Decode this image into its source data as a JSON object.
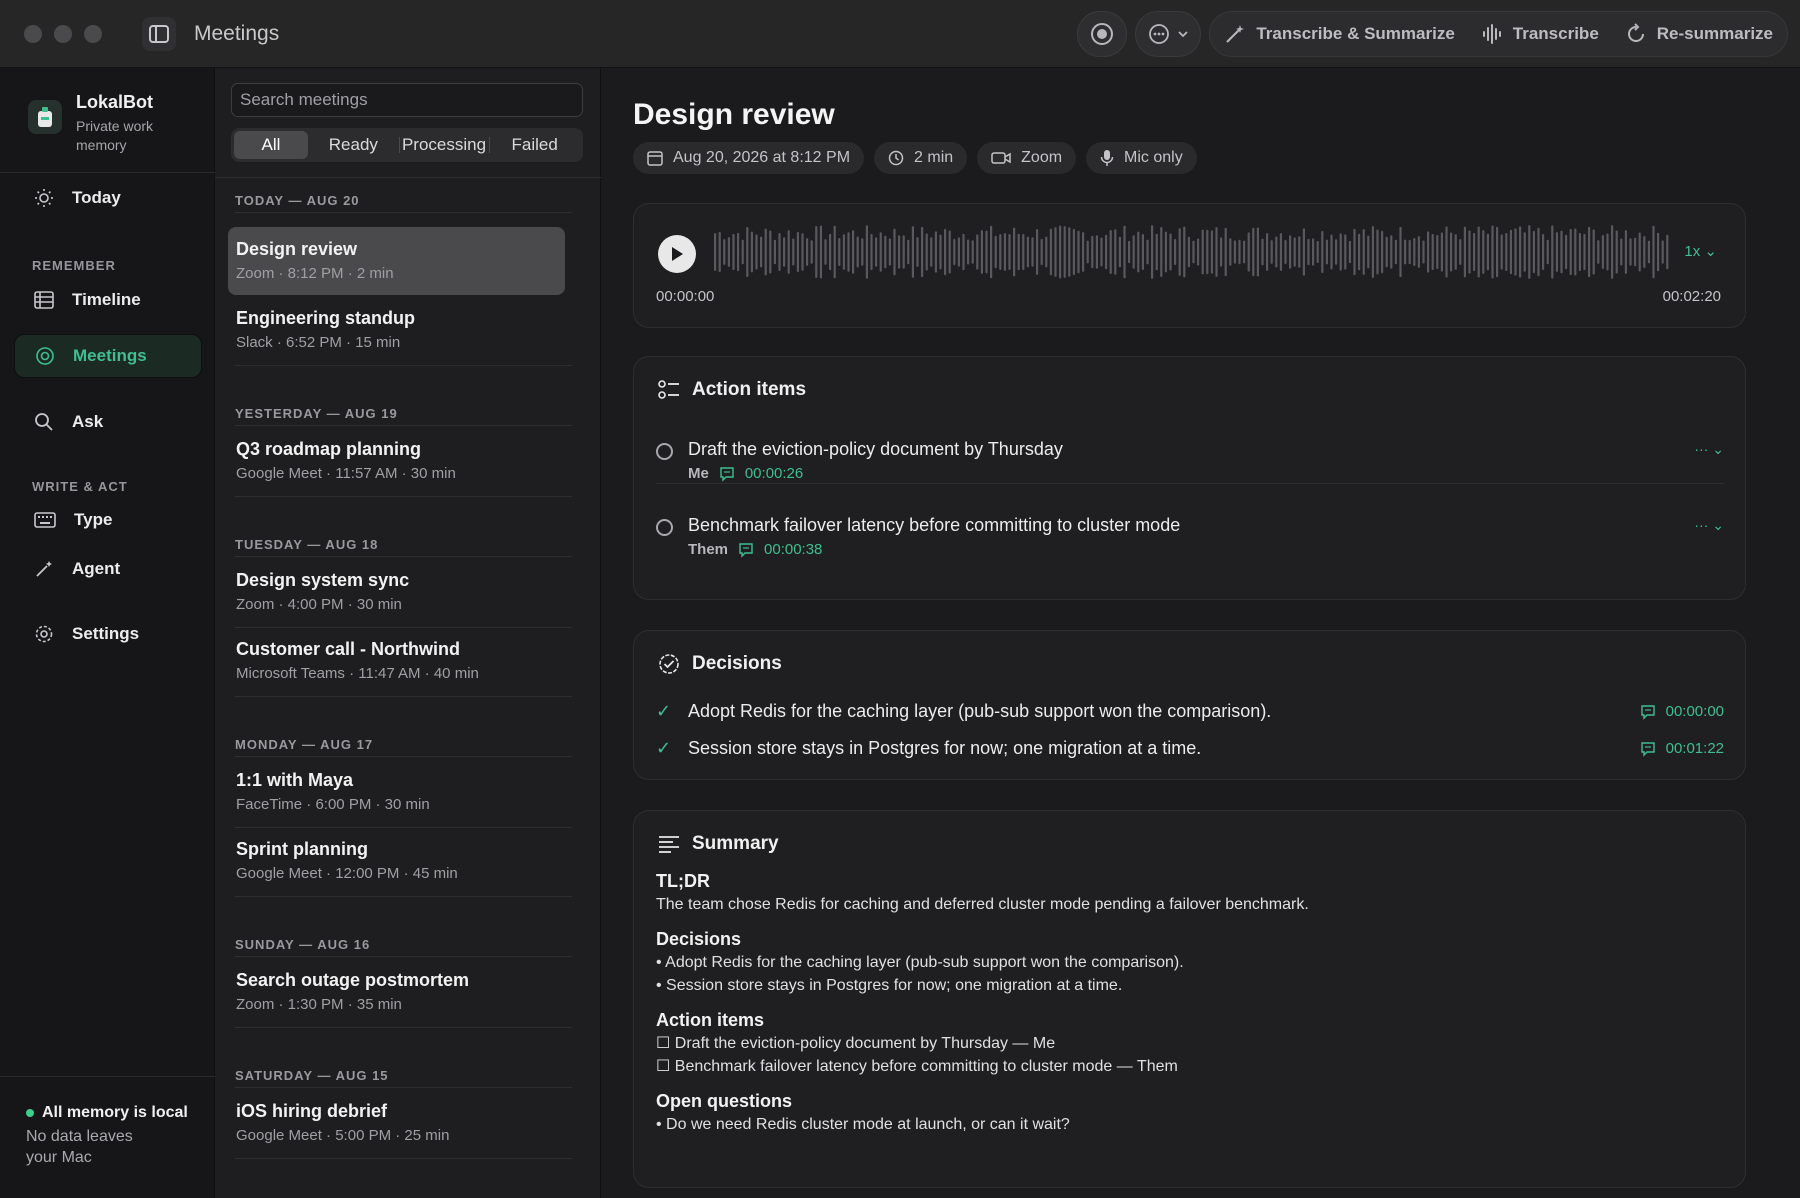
{
  "titlebar": {
    "title": "Meetings",
    "actions": {
      "transcribe_summarize": "Transcribe & Summarize",
      "transcribe": "Transcribe",
      "resummarize": "Re-summarize"
    }
  },
  "brand": {
    "name": "LokalBot",
    "subtitle": "Private work memory"
  },
  "nav": {
    "today": "Today",
    "section_remember": "REMEMBER",
    "timeline": "Timeline",
    "meetings": "Meetings",
    "ask": "Ask",
    "section_write": "WRITE & ACT",
    "type": "Type",
    "agent": "Agent",
    "settings": "Settings"
  },
  "local_status": {
    "title": "All memory is local",
    "subtitle": "No data leaves your Mac",
    "color": "#3ecf8e"
  },
  "list": {
    "search_placeholder": "Search meetings",
    "filters": [
      "All",
      "Ready",
      "Processing",
      "Failed"
    ],
    "active_filter": "All",
    "groups": [
      {
        "label": "TODAY — AUG 20",
        "meetings": [
          {
            "title": "Design review",
            "sub": "Zoom · 8:12 PM · 2 min",
            "selected": true
          },
          {
            "title": "Engineering standup",
            "sub": "Slack · 6:52 PM · 15 min"
          }
        ]
      },
      {
        "label": "YESTERDAY — AUG 19",
        "meetings": [
          {
            "title": "Q3 roadmap planning",
            "sub": "Google Meet · 11:57 AM · 30 min"
          }
        ]
      },
      {
        "label": "TUESDAY — AUG 18",
        "meetings": [
          {
            "title": "Design system sync",
            "sub": "Zoom · 4:00 PM · 30 min"
          },
          {
            "title": "Customer call - Northwind",
            "sub": "Microsoft Teams · 11:47 AM · 40 min"
          }
        ]
      },
      {
        "label": "MONDAY — AUG 17",
        "meetings": [
          {
            "title": "1:1 with Maya",
            "sub": "FaceTime · 6:00 PM · 30 min"
          },
          {
            "title": "Sprint planning",
            "sub": "Google Meet · 12:00 PM · 45 min"
          }
        ]
      },
      {
        "label": "SUNDAY — AUG 16",
        "meetings": [
          {
            "title": "Search outage postmortem",
            "sub": "Zoom · 1:30 PM · 35 min"
          }
        ]
      },
      {
        "label": "SATURDAY — AUG 15",
        "meetings": [
          {
            "title": "iOS hiring debrief",
            "sub": "Google Meet · 5:00 PM · 25 min"
          }
        ]
      }
    ]
  },
  "detail": {
    "title": "Design review",
    "date": "Aug 20, 2026 at 8:12 PM",
    "duration": "2 min",
    "platform": "Zoom",
    "audio": "Mic only",
    "player": {
      "speed": "1x",
      "position": "00:00:00",
      "length": "00:02:20"
    },
    "action_items": {
      "heading": "Action items",
      "items": [
        {
          "text": "Draft the eviction-policy document by Thursday",
          "owner": "Me",
          "timestamp": "00:00:26"
        },
        {
          "text": "Benchmark failover latency before committing to cluster mode",
          "owner": "Them",
          "timestamp": "00:00:38"
        }
      ]
    },
    "decisions": {
      "heading": "Decisions",
      "items": [
        {
          "text": "Adopt Redis for the caching layer (pub-sub support won the comparison).",
          "timestamp": "00:00:00"
        },
        {
          "text": "Session store stays in Postgres for now; one migration at a time.",
          "timestamp": "00:01:22"
        }
      ]
    },
    "summary": {
      "heading": "Summary",
      "tldr_h": "TL;DR",
      "tldr": "The team chose Redis for caching and deferred cluster mode pending a failover benchmark.",
      "decisions_h": "Decisions",
      "decisions": [
        "• Adopt Redis for the caching layer (pub-sub support won the comparison).",
        "• Session store stays in Postgres for now; one migration at a time."
      ],
      "actions_h": "Action items",
      "actions": [
        "☐ Draft the eviction-policy document by Thursday — Me",
        "☐ Benchmark failover latency before committing to cluster mode — Them"
      ],
      "questions_h": "Open questions",
      "questions": [
        "• Do we need Redis cluster mode at launch, or can it wait?"
      ]
    }
  },
  "colors": {
    "accent": "#3fbf8f",
    "background": "#1b1b1d"
  }
}
